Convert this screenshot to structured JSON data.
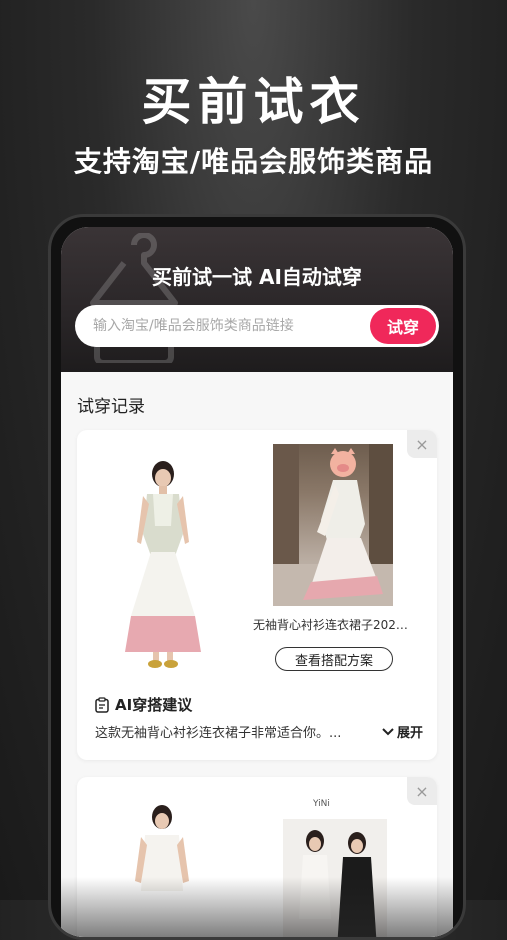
{
  "promo": {
    "title": "买前试衣",
    "subtitle": "支持淘宝/唯品会服饰类商品"
  },
  "app": {
    "hero_title": "买前试一试 AI自动试穿",
    "search": {
      "placeholder": "输入淘宝/唯品会服饰类商品链接",
      "value": ""
    },
    "try_button_label": "试穿",
    "accent_color": "#f0285a",
    "section_title": "试穿记录",
    "records": [
      {
        "product_name": "无袖背心衬衫连衣裙子2024...",
        "outfit_button_label": "查看搭配方案",
        "ai_heading": "AI穿搭建议",
        "ai_desc": "这款无袖背心衬衫连衣裙子非常适合你。...",
        "expand_label": "展开",
        "close_icon": "×"
      },
      {
        "product_name": "",
        "close_icon": "×",
        "brand_mark": "YiNi"
      }
    ]
  }
}
